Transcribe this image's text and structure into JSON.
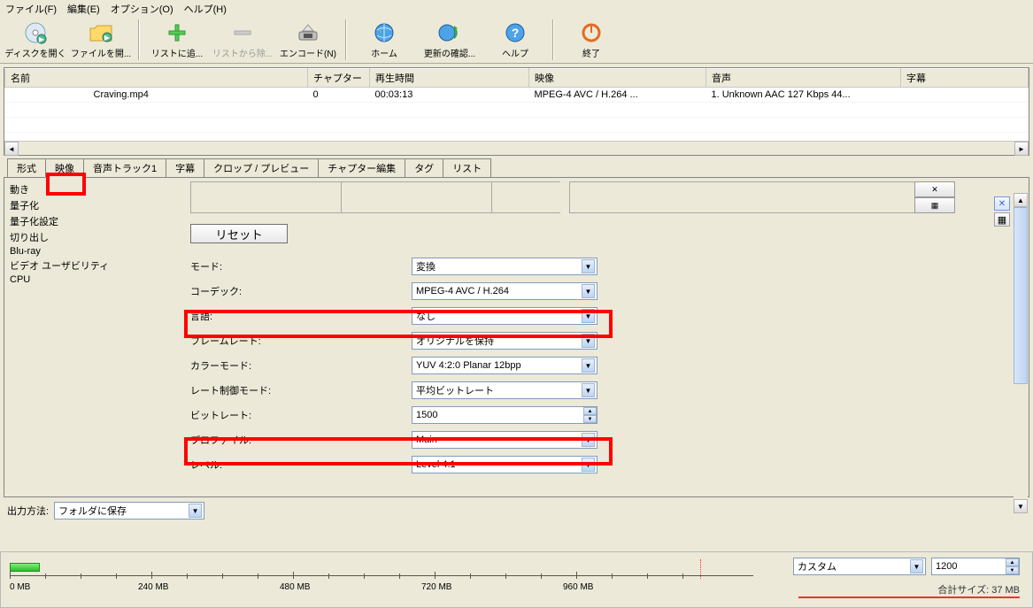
{
  "menu": {
    "file": "ファイル(F)",
    "edit": "編集(E)",
    "options": "オプション(O)",
    "help": "ヘルプ(H)"
  },
  "toolbar": {
    "open_disc": "ディスクを開く",
    "open_file": "ファイルを開...",
    "add_list": "リストに追...",
    "remove_list": "リストから除...",
    "encode": "エンコード(N)",
    "home": "ホーム",
    "check_update": "更新の確認...",
    "help": "ヘルプ",
    "exit": "終了"
  },
  "filelist": {
    "cols": {
      "name": "名前",
      "chapter": "チャプター",
      "duration": "再生時間",
      "video": "映像",
      "audio": "音声",
      "subtitle": "字幕"
    },
    "rows": [
      {
        "name": "Craving.mp4",
        "chapter": "0",
        "duration": "00:03:13",
        "video": "MPEG-4 AVC / H.264 ...",
        "audio": "1. Unknown AAC  127 Kbps 44...",
        "subtitle": ""
      }
    ]
  },
  "tabs": {
    "format": "形式",
    "video": "映像",
    "audio": "音声トラック1",
    "subs": "字幕",
    "crop": "クロップ / プレビュー",
    "chapedit": "チャプター編集",
    "tag": "タグ",
    "list": "リスト"
  },
  "side": {
    "i0": "動き",
    "i1": "量子化",
    "i2": "量子化設定",
    "i3": "切り出し",
    "i4": "Blu-ray",
    "i5": "ビデオ ユーザビリティ",
    "i6": "CPU"
  },
  "form": {
    "reset": "リセット",
    "mode_l": "モード:",
    "mode_v": "変換",
    "codec_l": "コーデック:",
    "codec_v": "MPEG-4 AVC / H.264",
    "lang_l": "言語:",
    "lang_v": "なし",
    "fps_l": "フレームレート:",
    "fps_v": "オリジナルを保持",
    "color_l": "カラーモード:",
    "color_v": "YUV 4:2:0 Planar 12bpp",
    "rate_l": "レート制御モード:",
    "rate_v": "平均ビットレート",
    "bitrate_l": "ビットレート:",
    "bitrate_v": "1500",
    "profile_l": "プロファイル:",
    "profile_v": "Main",
    "level_l": "レベル:",
    "level_v": "Level 4.1"
  },
  "output": {
    "label": "出力方法:",
    "value": "フォルダに保存"
  },
  "ruler": {
    "labels": {
      "t0": "0 MB",
      "t1": "240 MB",
      "t2": "480 MB",
      "t3": "720 MB",
      "t4": "960 MB"
    },
    "preset": "カスタム",
    "preset_val": "1200",
    "total_label": "合計サイズ:",
    "total_value": "37 MB"
  }
}
